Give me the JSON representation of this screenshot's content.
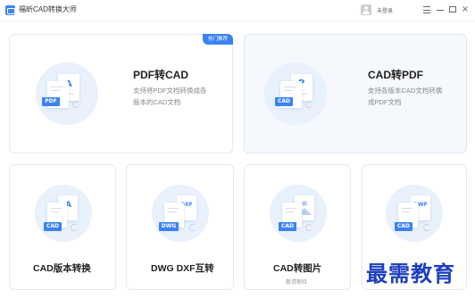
{
  "titlebar": {
    "app_title": "福昕CAD转换大师",
    "login_label": "未登录"
  },
  "cards": {
    "pdf_to_cad": {
      "badge": "热门推荐",
      "title": "PDF转CAD",
      "desc_line1": "支持将PDF文档转换成各",
      "desc_line2": "版本的CAD文档",
      "icon_tag": "PDF",
      "icon_glyph": "A"
    },
    "cad_to_pdf": {
      "title": "CAD转PDF",
      "desc_line1": "支持各版本CAD文档转换",
      "desc_line2": "成PDF文档",
      "icon_tag": "CAD",
      "icon_glyph": "P"
    },
    "cad_version": {
      "title": "CAD版本转换",
      "icon_tag": "CAD",
      "icon_glyph": "A"
    },
    "dwg_dxf": {
      "title": "DWG DXF互转",
      "icon_tag": "DWG",
      "icon_glyph": "DXF"
    },
    "cad_to_image": {
      "title": "CAD转图片",
      "subtitle": "敬请期待",
      "icon_tag": "CAD"
    },
    "cad_to_dwf": {
      "icon_tag": "CAD",
      "icon_glyph": "DWF"
    }
  },
  "watermark": "最需教育",
  "colors": {
    "accent": "#3b82f6",
    "icon_circle": "#e8f1fc",
    "watermark": "#1d3fbf"
  }
}
